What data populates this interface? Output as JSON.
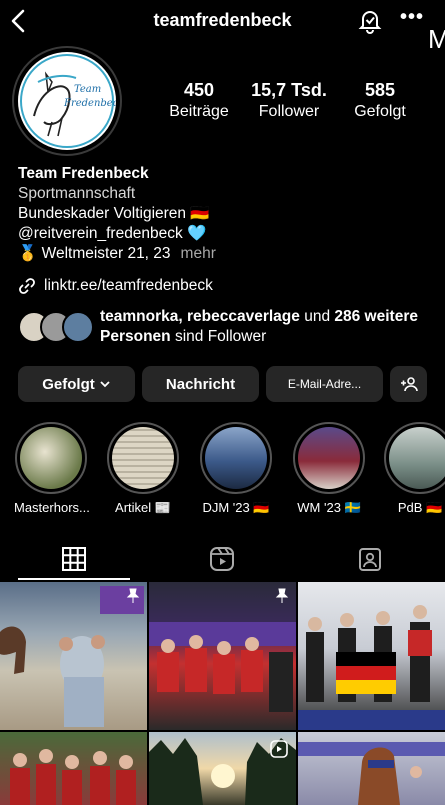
{
  "header": {
    "username": "teamfredenbeck",
    "edge_letter": "M"
  },
  "avatar": {
    "logo_text_1": "Team",
    "logo_text_2": "Fredenbeck"
  },
  "stats": [
    {
      "value": "450",
      "label": "Beiträge"
    },
    {
      "value": "15,7 Tsd.",
      "label": "Follower"
    },
    {
      "value": "585",
      "label": "Gefolgt"
    }
  ],
  "bio": {
    "name": "Team Fredenbeck",
    "category": "Sportmannschaft",
    "line1": "Bundeskader Voltigieren 🇩🇪",
    "line2": "@reitverein_fredenbeck 🩵",
    "line3": "🥇 Weltmeister 21, 23",
    "more": "mehr"
  },
  "link": {
    "text": "linktr.ee/teamfredenbeck"
  },
  "followed_by": {
    "names": "teamnorka, rebeccaverlage",
    "connector": " und ",
    "count_text": "286 weitere Personen",
    "suffix": " sind Follower"
  },
  "actions": {
    "following": "Gefolgt",
    "message": "Nachricht",
    "email": "E-Mail-Adre..."
  },
  "highlights": [
    {
      "label": "Masterhors...",
      "color": "#6b7a4a"
    },
    {
      "label": "Artikel 📰",
      "color": "#c9c2b0"
    },
    {
      "label": "DJM '23 🇩🇪",
      "color": "#3c5a8a"
    },
    {
      "label": "WM '23 🇸🇪",
      "color": "#8a2b3a"
    },
    {
      "label": "PdB 🇩🇪",
      "color": "#7b8f88"
    }
  ],
  "colors": {
    "background": "#000000",
    "button": "#262626",
    "muted": "#a8a8a8"
  }
}
